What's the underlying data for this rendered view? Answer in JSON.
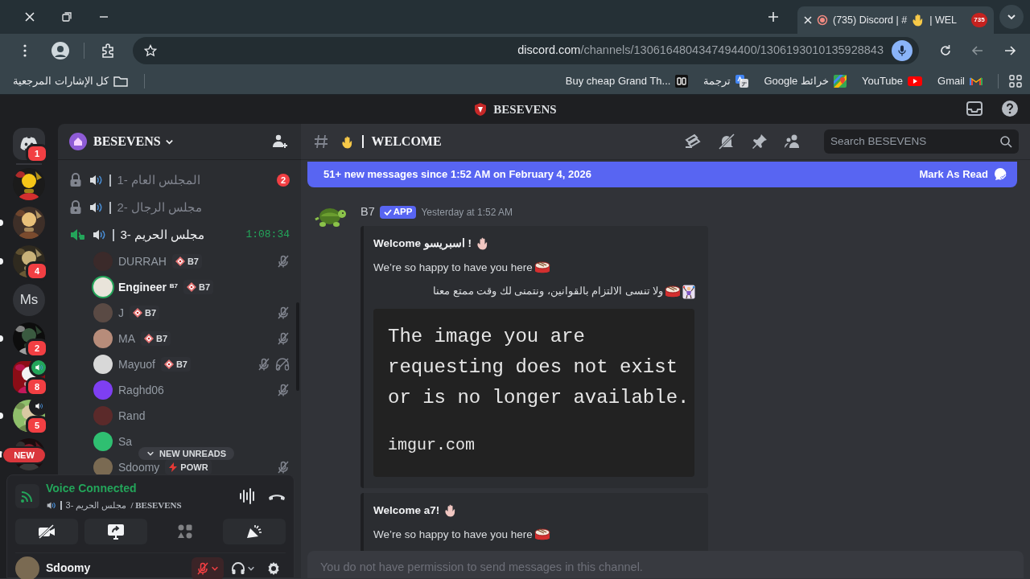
{
  "browser": {
    "tab": {
      "title": "(735) Discord | #",
      "title_end": "| WEL",
      "badge": "735"
    },
    "url": {
      "host": "discord.com",
      "path": "/channels/1306164804347494400/1306193010135928843"
    },
    "bookmarks": [
      {
        "kind": "site",
        "label": "Buy cheap Grand Th..."
      },
      {
        "kind": "translate",
        "label": "ترجمة"
      },
      {
        "kind": "maps",
        "label": "خرائط Google"
      },
      {
        "kind": "youtube",
        "label": "YouTube"
      },
      {
        "kind": "gmail",
        "label": "Gmail"
      }
    ],
    "all_bookmarks": "كل الإشارات المرجعية"
  },
  "app_title": "BESEVENS",
  "servers": [
    {
      "kind": "home",
      "badge": "1",
      "selected": false,
      "unread": false
    },
    {
      "kind": "picture",
      "selected": false,
      "unread": false
    },
    {
      "kind": "picture",
      "selected": false,
      "unread": true
    },
    {
      "kind": "picture",
      "selected": false,
      "unread": true,
      "badge": "4"
    },
    {
      "kind": "text",
      "label": "Ms",
      "selected": false,
      "unread": false
    },
    {
      "kind": "picture",
      "selected": false,
      "unread": true,
      "badge": "2"
    },
    {
      "kind": "picture",
      "selected": true,
      "unread": false,
      "voice": true,
      "badge": "8"
    },
    {
      "kind": "picture",
      "selected": false,
      "unread": true,
      "voice": true,
      "badge": "5"
    },
    {
      "kind": "picture",
      "selected": false,
      "unread": true,
      "pill": "NEW"
    }
  ],
  "server_name": "BESEVENS",
  "channels": [
    {
      "name": "المجلس العام -1",
      "locked": true,
      "connected": false,
      "badge": "2"
    },
    {
      "name": "مجلس الرجال -2",
      "locked": true,
      "connected": false
    },
    {
      "name": "مجلس الحريم -3",
      "locked": false,
      "connected": true,
      "timer": "1:08:34",
      "members": [
        {
          "name": "DURRAH",
          "tag": {
            "kind": "b7",
            "label": "B7"
          },
          "speaking": false,
          "muted": true,
          "deafened": false
        },
        {
          "name": "Engineer $^{B7}$",
          "tag": {
            "kind": "b7",
            "label": "B7"
          },
          "speaking": true,
          "muted": false,
          "deafened": false
        },
        {
          "name": "J",
          "tag": {
            "kind": "b7",
            "label": "B7"
          },
          "speaking": false,
          "muted": true,
          "deafened": false
        },
        {
          "name": "MA",
          "tag": {
            "kind": "b7",
            "label": "B7"
          },
          "speaking": false,
          "muted": true,
          "deafened": false
        },
        {
          "name": "Mayuof",
          "tag": {
            "kind": "b7",
            "label": "B7"
          },
          "speaking": false,
          "muted": true,
          "deafened": true
        },
        {
          "name": "Raghd06",
          "speaking": false,
          "muted": true,
          "deafened": false
        },
        {
          "name": "Rand",
          "speaking": false,
          "muted": false,
          "deafened": false
        },
        {
          "name": "Sa",
          "speaking": false,
          "muted": false,
          "deafened": false
        },
        {
          "name": "Sdoomy",
          "tag": {
            "kind": "powr",
            "label": "POWR"
          },
          "speaking": false,
          "muted": true,
          "deafened": false
        }
      ]
    }
  ],
  "new_unreads": "NEW UNREADS",
  "voice": {
    "status": "Voice Connected",
    "channel": "مجلس الحريم -3",
    "server": "/ BESEVENS",
    "buttons": [
      {
        "kind": "camera",
        "disabled": false
      },
      {
        "kind": "screen",
        "disabled": false
      },
      {
        "kind": "activities",
        "disabled": true
      },
      {
        "kind": "soundboard",
        "disabled": false
      }
    ]
  },
  "user": {
    "name": "Sdoomy",
    "muted": true
  },
  "chat": {
    "channel": "WELCOME",
    "search_placeholder": "Search BESEVENS",
    "banner": {
      "text": "51+ new messages since 1:52 AM on February 4, 2026",
      "action": "Mark As Read"
    },
    "messages": [
      {
        "author": "B7",
        "badge": "APP",
        "time": "Yesterday at 1:52 AM",
        "embeds": [
          {
            "title": "Welcome اسبريسو !",
            "lines": [
              {
                "text": "We’re so happy to have you here",
                "kind": "ltr",
                "trail": [
                  {
                    "kind": "drum"
                  }
                ]
              },
              {
                "text": "ولا تنسى الالتزام بالقوانين، ونتمنى لك وقت ممتع معنا",
                "kind": "rtl",
                "trail": [
                  {
                    "kind": "drum"
                  },
                  {
                    "kind": "juggler"
                  }
                ]
              }
            ],
            "image": {
              "text": "The image you are requesting does not exist or is no longer available.",
              "footer": "imgur.com"
            }
          },
          {
            "title": "Welcome a7!",
            "lines": [
              {
                "text": "We’re so happy to have you here",
                "kind": "ltr",
                "trail": [
                  {
                    "kind": "drum"
                  }
                ]
              }
            ]
          }
        ]
      }
    ],
    "input_placeholder": "You do not have permission to send messages in this channel."
  }
}
